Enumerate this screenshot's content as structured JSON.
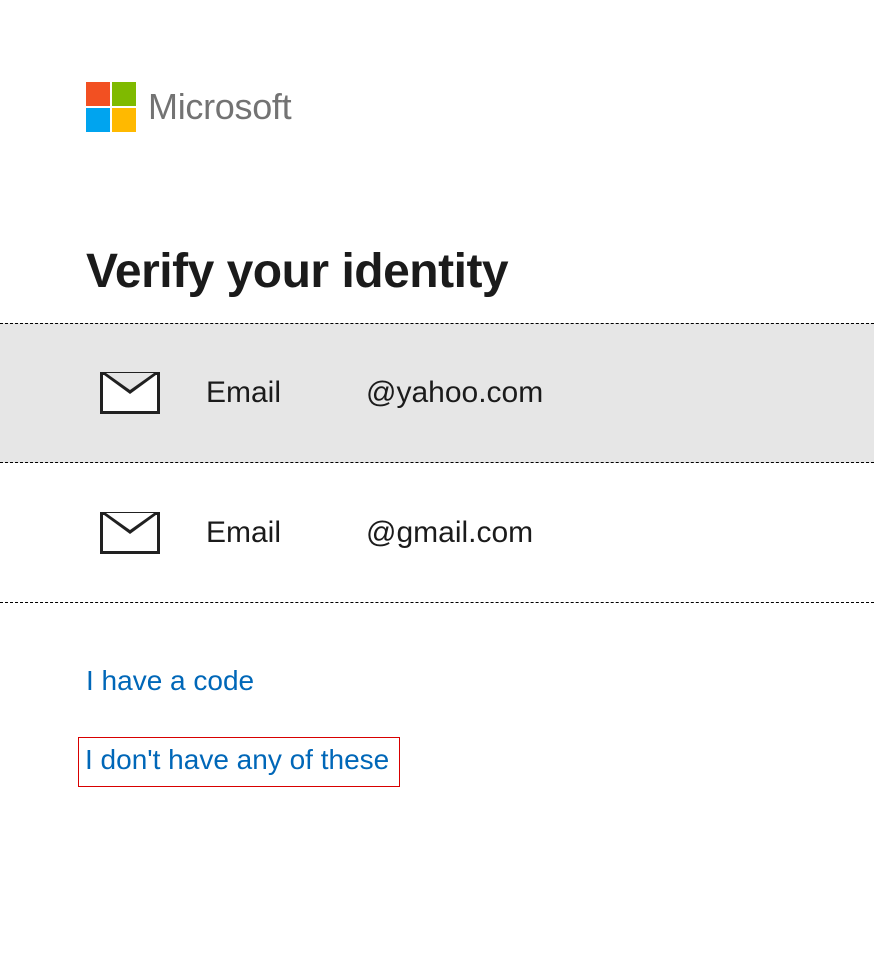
{
  "brand": {
    "name": "Microsoft"
  },
  "page": {
    "title": "Verify your identity"
  },
  "options": [
    {
      "label": "Email",
      "detail": "@yahoo.com"
    },
    {
      "label": "Email",
      "detail": "@gmail.com"
    }
  ],
  "links": {
    "have_code": "I have a code",
    "no_options": "I don't have any of these"
  }
}
